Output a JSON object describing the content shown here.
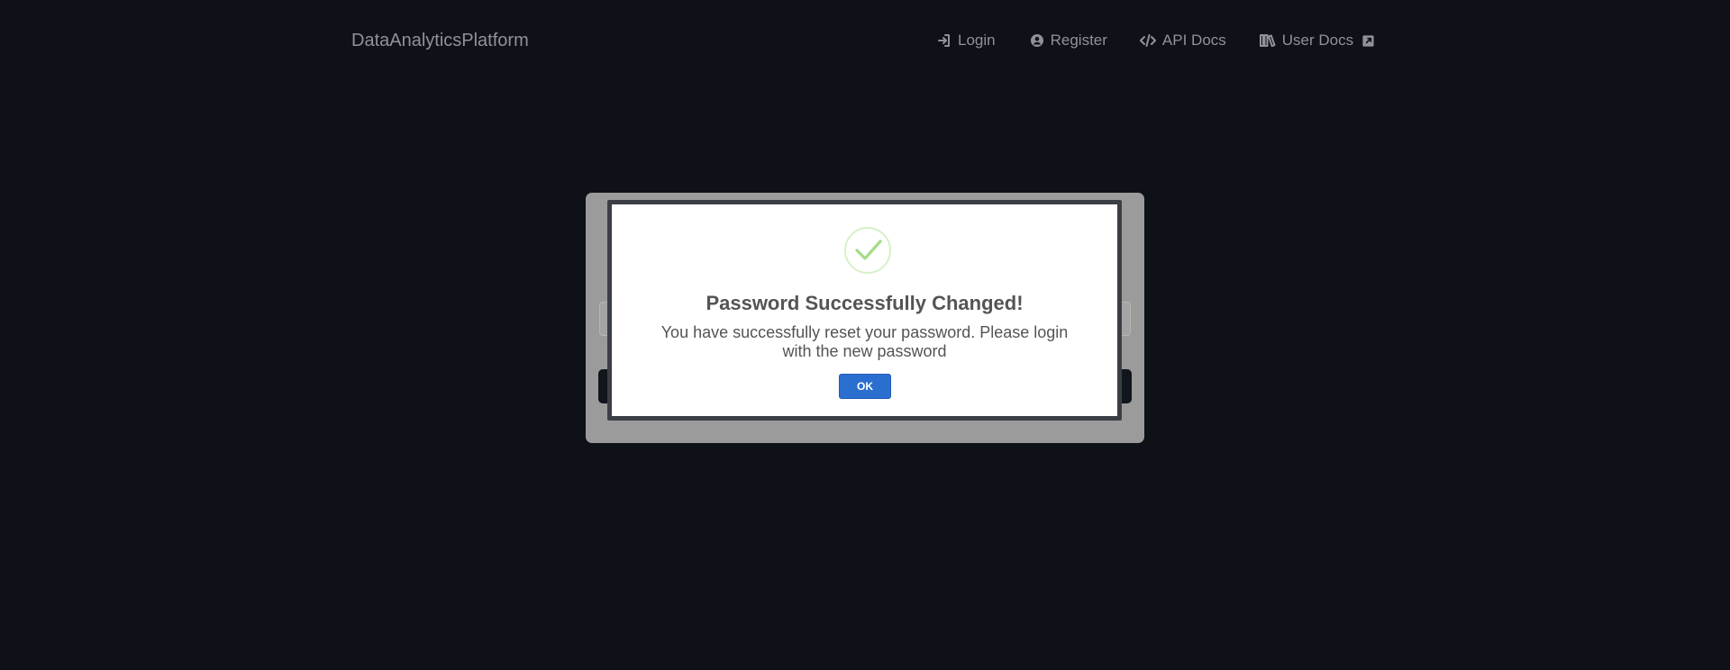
{
  "navbar": {
    "brand": "DataAnalyticsPlatform",
    "links": [
      {
        "label": "Login",
        "icon": "login-icon"
      },
      {
        "label": "Register",
        "icon": "user-circle-icon"
      },
      {
        "label": "API Docs",
        "icon": "code-icon"
      },
      {
        "label": "User Docs",
        "icon": "books-icon",
        "trailing_icon": "external-link-icon"
      }
    ]
  },
  "modal": {
    "icon": "success-check-icon",
    "title": "Password Successfully Changed!",
    "message": "You have successfully reset your password. Please login with the new password",
    "ok_label": "OK"
  },
  "colors": {
    "background": "#0e1117",
    "nav_text": "#8f9398",
    "ok_button": "#2a6fd0",
    "check": "#a5dc86"
  }
}
